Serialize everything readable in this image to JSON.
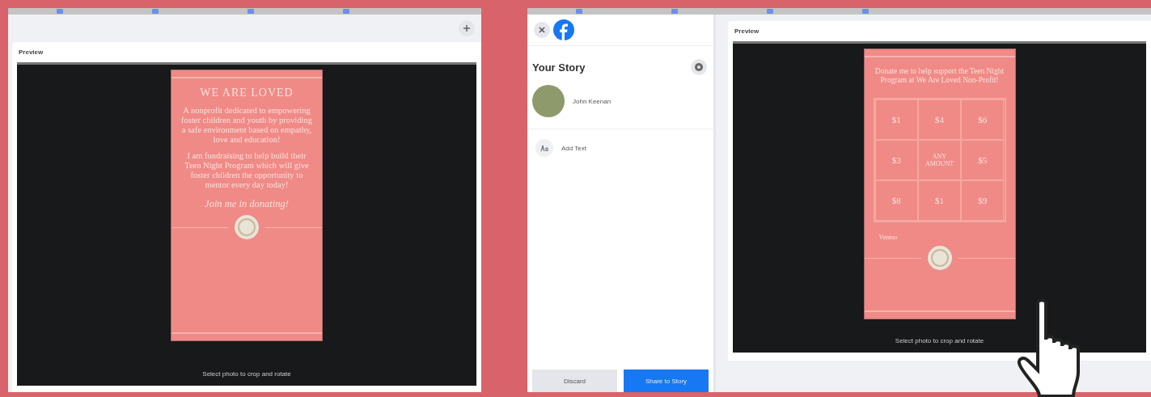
{
  "left_window": {
    "preview_title": "Preview",
    "story": {
      "heading": "WE ARE LOVED",
      "paragraphs": [
        "A nonprofit dedicated to empowering foster children and youth by providing a safe environment based on empathy, love and education!",
        "I am fundraising to help build their Teen Night Program which will give foster children the opportunity to mentor every day today!"
      ],
      "call_to_action": "Join me in donating!"
    },
    "caption": "Select photo to crop and rotate"
  },
  "right_window": {
    "sidebar": {
      "title": "Your Story",
      "user_name": "John Keenan",
      "add_text": "Add Text",
      "buttons": [
        {
          "label": "Discard",
          "kind": "secondary"
        },
        {
          "label": "Share to Story",
          "kind": "primary"
        }
      ]
    },
    "preview_title": "Preview",
    "story": {
      "heading": "Donate me to help support the Teen Night Program at We Are Loved Non-Profit!",
      "amounts": [
        "$1",
        "$4",
        "$6",
        "$3",
        "ANY AMOUNT",
        "$5",
        "$8",
        "$1",
        "$9"
      ],
      "footer": "Venmo"
    },
    "caption": "Select photo to crop and rotate"
  }
}
